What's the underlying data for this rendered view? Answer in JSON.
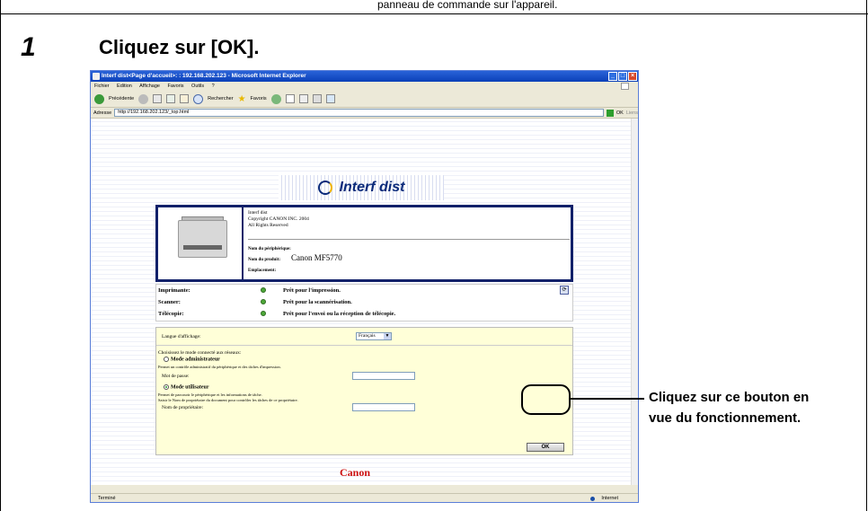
{
  "page": {
    "top_caption": "panneau de commande sur l'appareil.",
    "step_number": "1",
    "step_title": "Cliquez sur [OK].",
    "callout": "Cliquez sur ce bouton en vue du fonctionnement."
  },
  "browser": {
    "title": "Interf dist<Page d'accueil>: : 192.168.202.123 - Microsoft Internet Explorer",
    "menu": [
      "Fichier",
      "Edition",
      "Affichage",
      "Favoris",
      "Outils",
      "?"
    ],
    "toolbar": {
      "back": "Précédente",
      "search": "Rechercher",
      "favorites": "Favoris"
    },
    "address_label": "Adresse",
    "address": "http://192.168.202.123/_top.html",
    "go_label": "OK",
    "links_label": "Liens",
    "status_done": "Terminé",
    "status_zone": "Internet"
  },
  "content": {
    "banner_title": "Interf dist",
    "device": {
      "line1": "Interf dist",
      "line2": "Copyright CANON INC. 2004",
      "line3": "All Rights Reserved",
      "device_name_label": "Nom du périphérique:",
      "product_name_label": "Nom du produit:",
      "product_name": "Canon MF5770",
      "location_label": "Emplacement:"
    },
    "status": [
      {
        "label": "Imprimante:",
        "message": "Prêt pour l'impression."
      },
      {
        "label": "Scanner:",
        "message": "Prêt pour la scannérisation."
      },
      {
        "label": "Télécopie:",
        "message": "Prêt pour l'envoi ou la réception de télécopie."
      }
    ],
    "login": {
      "language_label": "Langue d'affichage:",
      "language_value": "Français",
      "choose_mode": "Choisissez le mode connecté aux réseaux:",
      "admin_mode": "Mode administrateur",
      "admin_desc": "Permet un contrôle administratif du périphérique et des tâches d'impression.",
      "password_label": "Mot de passe:",
      "user_mode": "Mode utilisateur",
      "user_desc1": "Permet de parcourir le périphérique et les informations de tâche.",
      "user_desc2": "Saisir le Nom de propriétaire du document pour contrôler les tâches de ce propriétaire.",
      "owner_label": "Nom de propriétaire:",
      "ok_label": "OK"
    },
    "brand_logo": "Canon"
  }
}
